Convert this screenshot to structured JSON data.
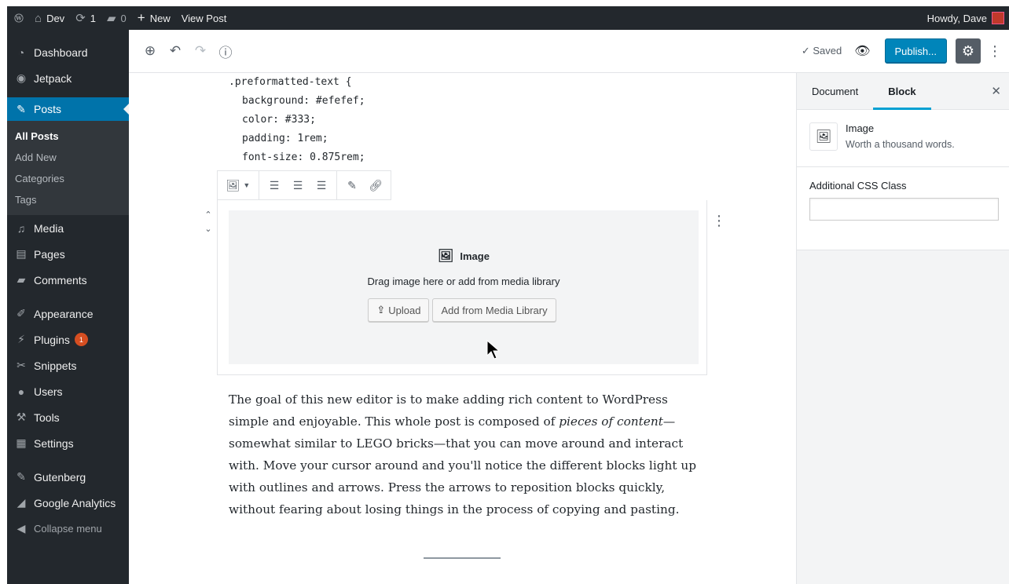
{
  "adminbar": {
    "site_name": "Dev",
    "updates_count": "1",
    "comments_count": "0",
    "new_label": "New",
    "view_post_label": "View Post",
    "greeting": "Howdy, Dave"
  },
  "menu": {
    "dashboard": "Dashboard",
    "jetpack": "Jetpack",
    "posts": "Posts",
    "posts_sub": [
      "All Posts",
      "Add New",
      "Categories",
      "Tags"
    ],
    "media": "Media",
    "pages": "Pages",
    "comments": "Comments",
    "appearance": "Appearance",
    "plugins": "Plugins",
    "plugins_badge": "1",
    "snippets": "Snippets",
    "users": "Users",
    "tools": "Tools",
    "settings": "Settings",
    "gutenberg": "Gutenberg",
    "google_analytics": "Google Analytics",
    "collapse": "Collapse menu"
  },
  "header": {
    "saved_label": "Saved",
    "publish_label": "Publish..."
  },
  "content": {
    "code_lines": [
      ".preformatted-text {",
      "background: #efefef;",
      "color: #333;",
      "padding: 1rem;",
      "font-size: 0.875rem;"
    ],
    "image_block": {
      "label": "Image",
      "instructions": "Drag image here or add from media library",
      "upload_label": "Upload",
      "media_library_label": "Add from Media Library"
    },
    "paragraph": {
      "before": "The goal of this new editor is to make adding rich content to WordPress simple and enjoyable. This whole post is composed of ",
      "emphasis": "pieces of content",
      "after": "—somewhat similar to LEGO bricks—that you can move around and interact with. Move your cursor around and you'll notice the different blocks light up with outlines and arrows. Press the arrows to reposition blocks quickly, without fearing about losing things in the process of copying and pasting."
    }
  },
  "sidebar": {
    "tab_document": "Document",
    "tab_block": "Block",
    "block_title": "Image",
    "block_description": "Worth a thousand words.",
    "css_class_label": "Additional CSS Class",
    "css_class_value": ""
  },
  "colors": {
    "admin_dark": "#23282d",
    "accent_blue": "#0073aa",
    "publish_blue": "#0085ba",
    "tab_underline": "#00a0d2"
  },
  "icons": {
    "wordpress": "wordpress-logo-icon",
    "home": "home-icon",
    "updates": "updates-icon",
    "comments": "comment-bubble-icon",
    "plus": "plus-icon",
    "undo": "undo-icon",
    "redo": "redo-icon",
    "info": "info-icon",
    "check": "checkmark-icon",
    "eye": "eye-icon",
    "gear": "gear-icon",
    "ellipsis": "vertical-ellipsis-icon"
  }
}
